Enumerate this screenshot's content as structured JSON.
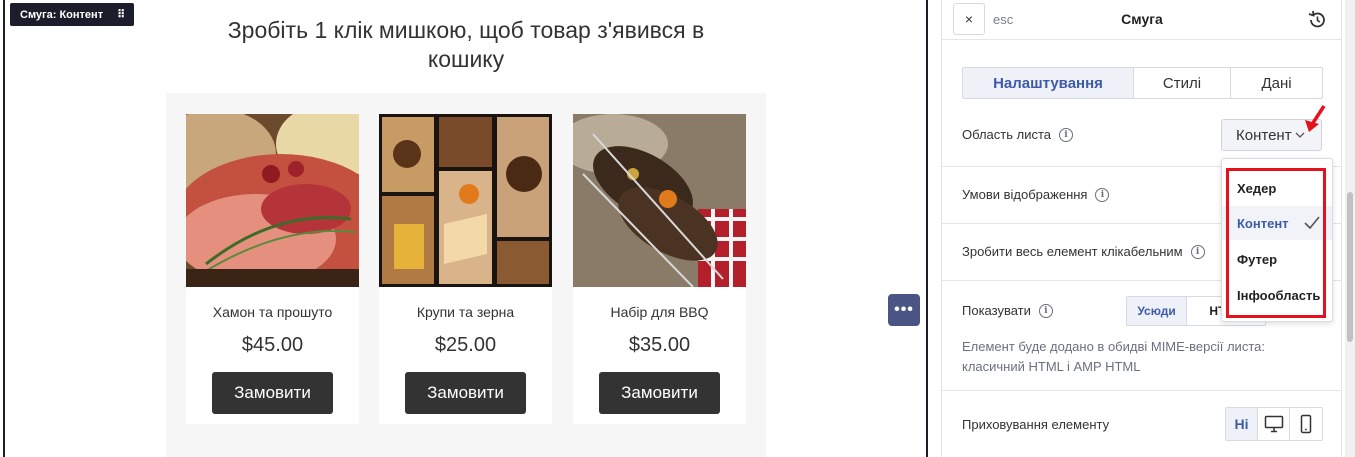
{
  "canvas": {
    "stripe_badge": "Смуга: Контент",
    "headline": "Зробіть 1 клік мишкою, щоб товар з'явився в кошику",
    "products": [
      {
        "name": "Хамон та прошуто",
        "price": "$45.00",
        "button": "Замовити",
        "image": "cured-meat-photo"
      },
      {
        "name": "Крупи та зерна",
        "price": "$25.00",
        "button": "Замовити",
        "image": "coffee-grains-photo"
      },
      {
        "name": "Набір для BBQ",
        "price": "$35.00",
        "button": "Замовити",
        "image": "bbq-skewers-photo"
      }
    ],
    "more_button": "•••"
  },
  "panel": {
    "close_label": "×",
    "esc_label": "esc",
    "title": "Смуга",
    "tabs": [
      {
        "label": "Налаштування",
        "active": true
      },
      {
        "label": "Стилі",
        "active": false
      },
      {
        "label": "Дані",
        "active": false
      }
    ],
    "area": {
      "label": "Область листа",
      "selected": "Контент"
    },
    "display_conditions": {
      "label": "Умови відображення"
    },
    "clickable": {
      "label": "Зробити весь елемент клікабельним"
    },
    "show": {
      "label": "Показувати",
      "options": [
        "Усюди",
        "HTML"
      ],
      "selected": "Усюди"
    },
    "mime_note": "Елемент буде додано в обидві MIME-версії листа: класичний HTML і AMP HTML",
    "hide": {
      "label": "Приховування елементу",
      "options": [
        "Ні",
        "desktop-icon",
        "mobile-icon"
      ],
      "selected": "Ні"
    }
  },
  "dropdown": {
    "options": [
      {
        "label": "Хедер",
        "selected": false
      },
      {
        "label": "Контент",
        "selected": true
      },
      {
        "label": "Футер",
        "selected": false
      },
      {
        "label": "Інфообласть",
        "selected": false
      }
    ]
  },
  "colors": {
    "accent": "#3d5ba7",
    "highlight": "#e4121d",
    "dark": "#1b1d2b",
    "button": "#333333",
    "more_button": "#4b5584"
  }
}
